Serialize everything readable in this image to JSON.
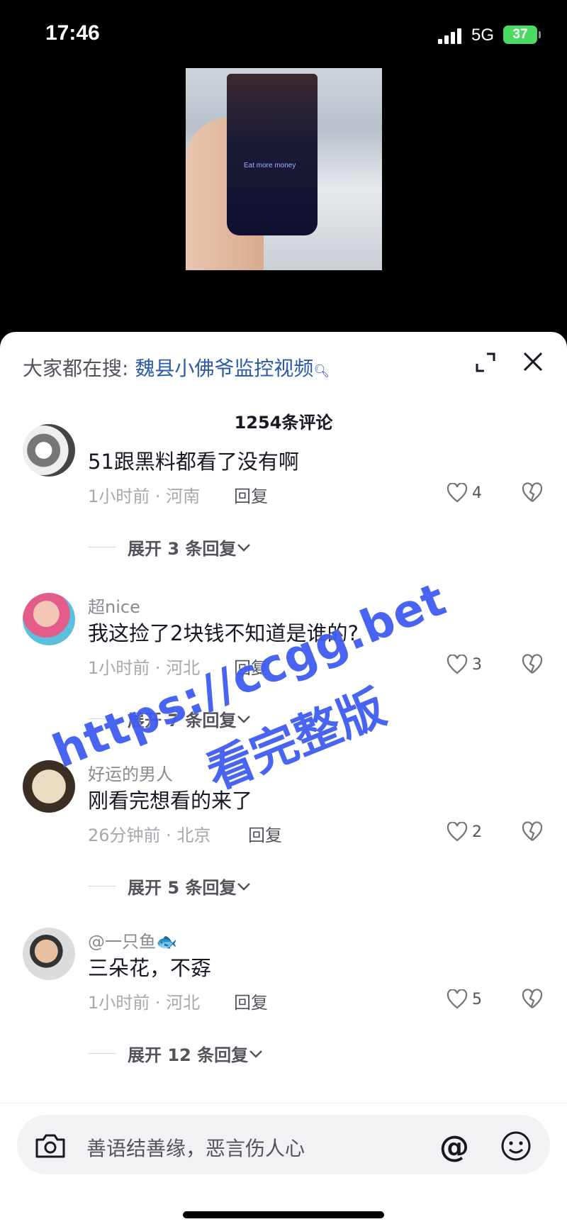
{
  "status": {
    "time": "17:46",
    "network": "5G",
    "battery": "37"
  },
  "video": {
    "cup_text": "Eat more money"
  },
  "sheet": {
    "search_prefix": "大家都在搜:",
    "search_term": "魏县小佛爷监控视频",
    "comment_count": "1254条评论"
  },
  "comments": [
    {
      "username": "",
      "text": "51跟黑料都看了没有啊",
      "time_location": "1小时前 · 河南",
      "reply_label": "回复",
      "likes": "4",
      "expand_label": "展开 3 条回复"
    },
    {
      "username": "超nice",
      "text": "我这捡了2块钱不知道是谁的?",
      "time_location": "1小时前 · 河北",
      "reply_label": "回复",
      "likes": "3",
      "expand_label": "展开 7 条回复"
    },
    {
      "username": "好运的男人",
      "text": "刚看完想看的来了",
      "time_location": "26分钟前 · 北京",
      "reply_label": "回复",
      "likes": "2",
      "expand_label": "展开 5 条回复"
    },
    {
      "username": "@一只鱼🐟",
      "text": "三朵花，不孬",
      "time_location": "1小时前 · 河北",
      "reply_label": "回复",
      "likes": "5",
      "expand_label": "展开 12 条回复"
    }
  ],
  "watermark": {
    "line1": "https://ccgg.bet",
    "line2": "看完整版"
  },
  "input": {
    "placeholder": "善语结善缘，恶言伤人心",
    "at_symbol": "@"
  },
  "colors": {
    "accent_link": "#2a5aa8",
    "watermark": "#3f5cf0",
    "battery": "#4cd964"
  }
}
